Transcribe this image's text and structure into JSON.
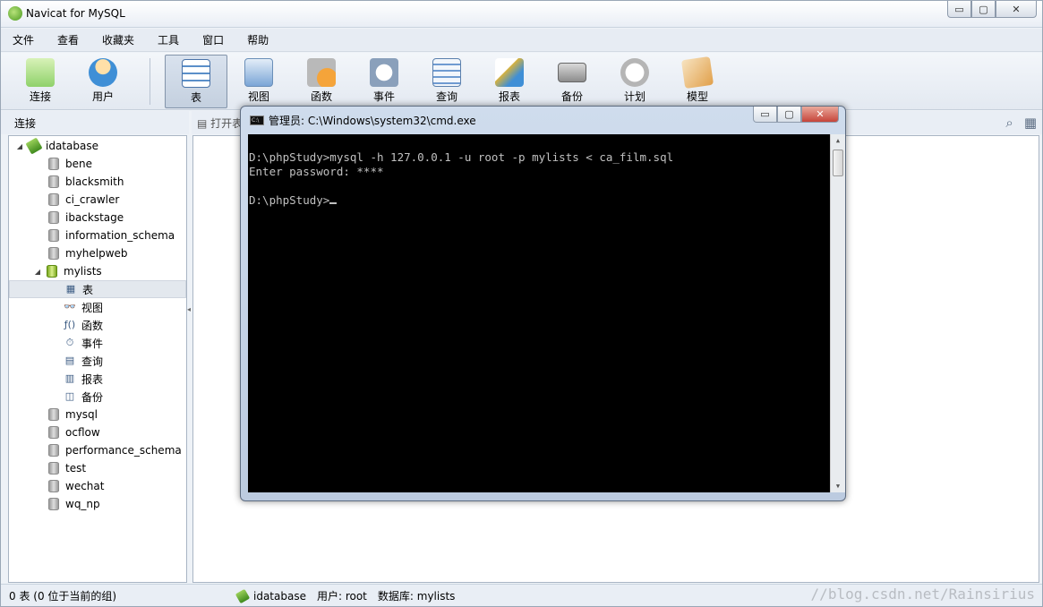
{
  "app": {
    "title": "Navicat for MySQL",
    "window_buttons": {
      "minimize": "▭",
      "maximize": "▢",
      "close": "✕"
    }
  },
  "menu": [
    "文件",
    "查看",
    "收藏夹",
    "工具",
    "窗口",
    "帮助"
  ],
  "toolbar": [
    {
      "label": "连接",
      "icon": "plug-icon",
      "color": "#8fd16a"
    },
    {
      "label": "用户",
      "icon": "user-icon",
      "color": "#f0b84a"
    },
    {
      "label": "表",
      "icon": "table-icon",
      "color": "#5b8fc9",
      "active": true
    },
    {
      "label": "视图",
      "icon": "view-icon",
      "color": "#7aa5d6"
    },
    {
      "label": "函数",
      "icon": "function-icon",
      "color": "#e08a2e"
    },
    {
      "label": "事件",
      "icon": "event-icon",
      "color": "#8aa0bb"
    },
    {
      "label": "查询",
      "icon": "query-icon",
      "color": "#6f9bd1"
    },
    {
      "label": "报表",
      "icon": "report-icon",
      "color": "#d6b23e"
    },
    {
      "label": "备份",
      "icon": "backup-icon",
      "color": "#9a9a9a"
    },
    {
      "label": "计划",
      "icon": "schedule-icon",
      "color": "#b5b5b5"
    },
    {
      "label": "模型",
      "icon": "model-icon",
      "color": "#e1a04a"
    }
  ],
  "left_header": "连接",
  "object_toolbar": {
    "open_button": "打开表"
  },
  "tree": {
    "connection": "idatabase",
    "databases_before": [
      "bene",
      "blacksmith",
      "ci_crawler",
      "ibackstage",
      "information_schema",
      "myhelpweb"
    ],
    "open_database": "mylists",
    "open_children": [
      {
        "label": "表",
        "icon": "table-icon",
        "glyph": "▦",
        "selected": true
      },
      {
        "label": "视图",
        "icon": "view-icon",
        "glyph": "👓"
      },
      {
        "label": "函数",
        "icon": "function-icon",
        "glyph": "ƒ()"
      },
      {
        "label": "事件",
        "icon": "event-icon",
        "glyph": "⏱"
      },
      {
        "label": "查询",
        "icon": "query-icon",
        "glyph": "▤"
      },
      {
        "label": "报表",
        "icon": "report-icon",
        "glyph": "▥"
      },
      {
        "label": "备份",
        "icon": "backup-icon",
        "glyph": "◫"
      }
    ],
    "databases_after": [
      "mysql",
      "ocflow",
      "performance_schema",
      "test",
      "wechat",
      "wq_np"
    ]
  },
  "statusbar": {
    "left": "0 表 (0 位于当前的组)",
    "connection": "idatabase",
    "user": "用户: root",
    "database": "数据库: mylists",
    "watermark": "//blog.csdn.net/Rainsirius"
  },
  "cmd": {
    "title": "管理员: C:\\Windows\\system32\\cmd.exe",
    "icon_text": "C:\\",
    "lines": [
      "D:\\phpStudy>mysql -h 127.0.0.1 -u root -p mylists < ca_film.sql",
      "Enter password: ****",
      "",
      "D:\\phpStudy>"
    ]
  }
}
